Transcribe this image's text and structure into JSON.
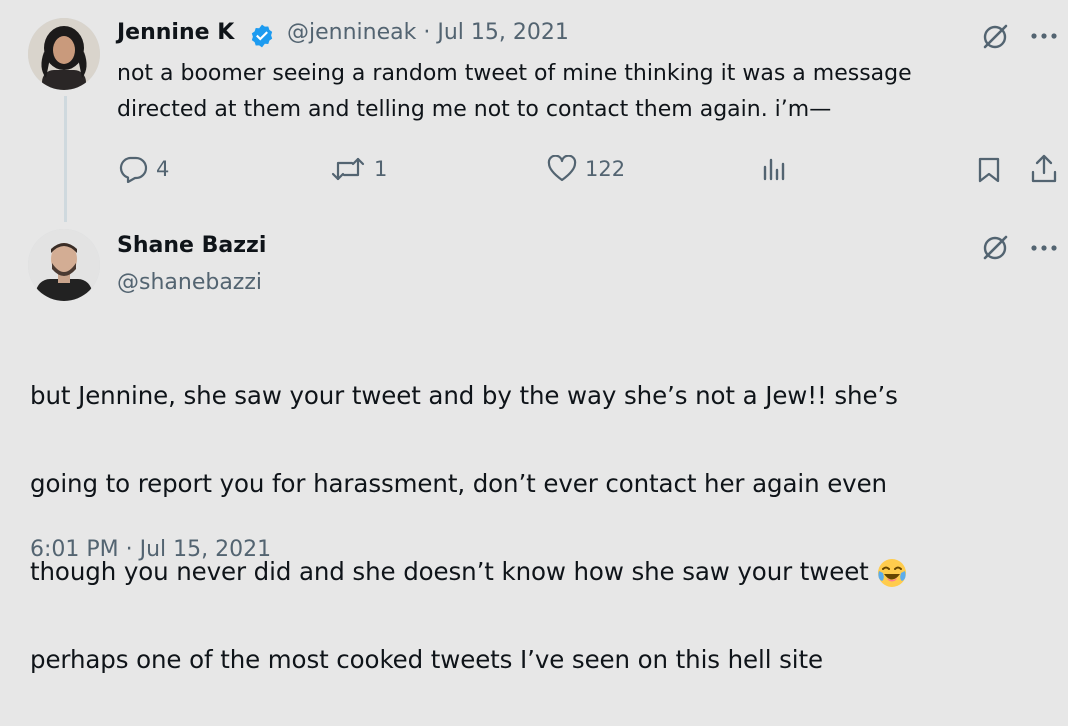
{
  "original_tweet": {
    "author_name": "Jennine K",
    "handle_date": "@jennineak · Jul 15, 2021",
    "text": "not a boomer seeing a random tweet of mine thinking it was a message\ndirected at them and telling me not to contact them again. i’m—",
    "replies": "4",
    "retweets": "1",
    "likes": "122",
    "verified": true
  },
  "main_tweet": {
    "author_name": "Shane Bazzi",
    "handle": "@shanebazzi",
    "text_line1": "but Jennine, she saw your tweet and by the way she’s not a Jew!! she’s",
    "text_line2": "going to report you for harassment, don’t ever contact her again even",
    "text_line3": "though you never did and she doesn’t know how she saw your tweet",
    "text_line4": "perhaps one of the most cooked tweets I’ve seen on this hell site",
    "timestamp": "6:01 PM · Jul 15, 2021"
  },
  "colors": {
    "background": "#e7e7e7",
    "verified": "#1d9bf0",
    "muted": "#536471"
  },
  "icons": [
    "grok-icon",
    "more-icon",
    "reply-icon",
    "retweet-icon",
    "like-icon",
    "views-icon",
    "bookmark-icon",
    "share-icon",
    "verified-badge-icon",
    "tears-of-joy-emoji"
  ]
}
